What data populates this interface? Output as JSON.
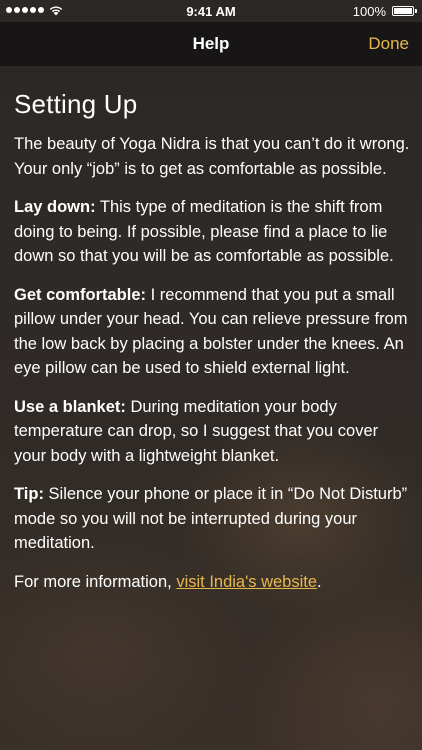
{
  "status_bar": {
    "time": "9:41 AM",
    "battery_percent": "100%",
    "battery_level": 1.0
  },
  "nav": {
    "title": "Help",
    "done_label": "Done"
  },
  "content": {
    "heading": "Setting Up",
    "intro": "The beauty of Yoga Nidra is that you can’t do it wrong. Your only “job” is to get as comfortable as possible.",
    "sections": [
      {
        "label": "Lay down:",
        "text": " This type of meditation is the shift from doing to being. If possible, please find a place to lie down so that you will be as comfortable as possible."
      },
      {
        "label": "Get comfortable:",
        "text": " I recommend that you put a small pillow under your head. You can relieve pressure from the low back by placing a bolster under the knees. An eye pillow can be used to shield external light."
      },
      {
        "label": "Use a blanket:",
        "text": " During meditation your body temperature can drop, so I suggest that you cover your body with a lightweight blanket."
      },
      {
        "label": "Tip:",
        "text": " Silence your phone or place it in “Do Not Disturb” mode so you will not be interrupted during your meditation."
      }
    ],
    "more_info_prefix": "For more information, ",
    "more_info_link": "visit India's website",
    "more_info_suffix": "."
  },
  "colors": {
    "accent": "#e8b84b",
    "nav_background": "#161413",
    "text": "#ffffff"
  }
}
